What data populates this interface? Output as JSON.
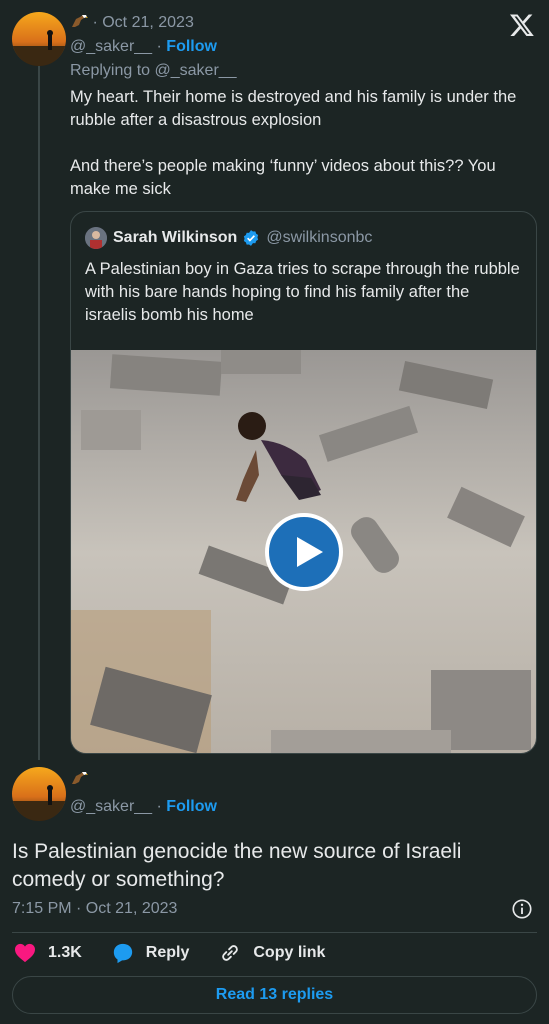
{
  "tweet1": {
    "date": "Oct 21, 2023",
    "handle": "@_saker__",
    "follow": "Follow",
    "replying_prefix": "Replying to",
    "replying_to": "@_saker__",
    "text": "My heart. Their home is destroyed and his family is under the rubble after a disastrous explosion\n\nAnd there’s people making ‘funny’ videos about this?? You make me sick"
  },
  "quote": {
    "name": "Sarah Wilkinson",
    "handle": "@swilkinsonbc",
    "text": "A Palestinian boy in Gaza tries to scrape through the rubble with his bare hands hoping to find his family after the israelis bomb his home"
  },
  "tweet2": {
    "handle": "@_saker__",
    "follow": "Follow",
    "text": "Is Palestinian genocide the new source of Israeli comedy or something?",
    "timestamp": "7:15 PM · Oct 21, 2023"
  },
  "actions": {
    "likes": "1.3K",
    "reply": "Reply",
    "copy_link": "Copy link"
  },
  "read_replies": "Read 13 replies",
  "colors": {
    "accent": "#1d9bf0",
    "like": "#f91880",
    "background": "#1c2524"
  }
}
